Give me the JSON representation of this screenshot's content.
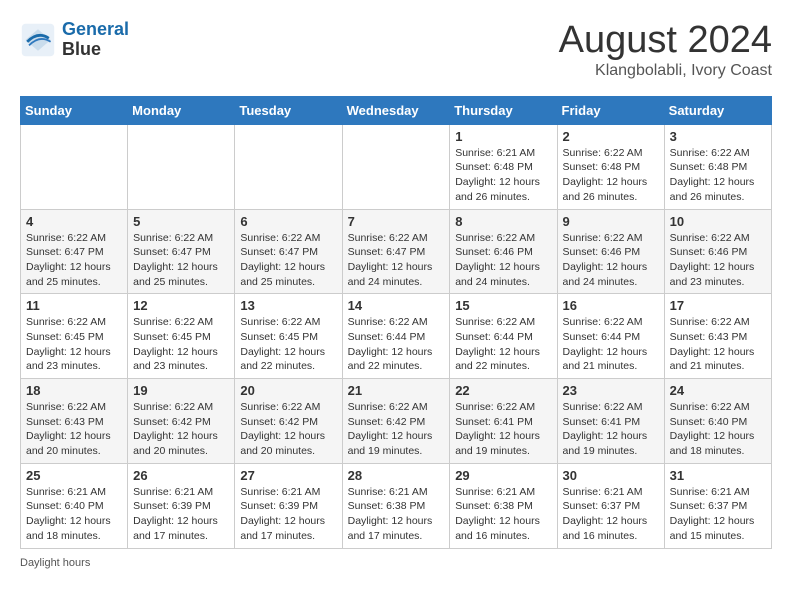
{
  "header": {
    "logo_line1": "General",
    "logo_line2": "Blue",
    "main_title": "August 2024",
    "subtitle": "Klangbolabli, Ivory Coast"
  },
  "footer": {
    "daylight_label": "Daylight hours"
  },
  "days_of_week": [
    "Sunday",
    "Monday",
    "Tuesday",
    "Wednesday",
    "Thursday",
    "Friday",
    "Saturday"
  ],
  "weeks": [
    {
      "days": [
        {
          "num": "",
          "info": ""
        },
        {
          "num": "",
          "info": ""
        },
        {
          "num": "",
          "info": ""
        },
        {
          "num": "",
          "info": ""
        },
        {
          "num": "1",
          "info": "Sunrise: 6:21 AM\nSunset: 6:48 PM\nDaylight: 12 hours\nand 26 minutes."
        },
        {
          "num": "2",
          "info": "Sunrise: 6:22 AM\nSunset: 6:48 PM\nDaylight: 12 hours\nand 26 minutes."
        },
        {
          "num": "3",
          "info": "Sunrise: 6:22 AM\nSunset: 6:48 PM\nDaylight: 12 hours\nand 26 minutes."
        }
      ]
    },
    {
      "days": [
        {
          "num": "4",
          "info": "Sunrise: 6:22 AM\nSunset: 6:47 PM\nDaylight: 12 hours\nand 25 minutes."
        },
        {
          "num": "5",
          "info": "Sunrise: 6:22 AM\nSunset: 6:47 PM\nDaylight: 12 hours\nand 25 minutes."
        },
        {
          "num": "6",
          "info": "Sunrise: 6:22 AM\nSunset: 6:47 PM\nDaylight: 12 hours\nand 25 minutes."
        },
        {
          "num": "7",
          "info": "Sunrise: 6:22 AM\nSunset: 6:47 PM\nDaylight: 12 hours\nand 24 minutes."
        },
        {
          "num": "8",
          "info": "Sunrise: 6:22 AM\nSunset: 6:46 PM\nDaylight: 12 hours\nand 24 minutes."
        },
        {
          "num": "9",
          "info": "Sunrise: 6:22 AM\nSunset: 6:46 PM\nDaylight: 12 hours\nand 24 minutes."
        },
        {
          "num": "10",
          "info": "Sunrise: 6:22 AM\nSunset: 6:46 PM\nDaylight: 12 hours\nand 23 minutes."
        }
      ]
    },
    {
      "days": [
        {
          "num": "11",
          "info": "Sunrise: 6:22 AM\nSunset: 6:45 PM\nDaylight: 12 hours\nand 23 minutes."
        },
        {
          "num": "12",
          "info": "Sunrise: 6:22 AM\nSunset: 6:45 PM\nDaylight: 12 hours\nand 23 minutes."
        },
        {
          "num": "13",
          "info": "Sunrise: 6:22 AM\nSunset: 6:45 PM\nDaylight: 12 hours\nand 22 minutes."
        },
        {
          "num": "14",
          "info": "Sunrise: 6:22 AM\nSunset: 6:44 PM\nDaylight: 12 hours\nand 22 minutes."
        },
        {
          "num": "15",
          "info": "Sunrise: 6:22 AM\nSunset: 6:44 PM\nDaylight: 12 hours\nand 22 minutes."
        },
        {
          "num": "16",
          "info": "Sunrise: 6:22 AM\nSunset: 6:44 PM\nDaylight: 12 hours\nand 21 minutes."
        },
        {
          "num": "17",
          "info": "Sunrise: 6:22 AM\nSunset: 6:43 PM\nDaylight: 12 hours\nand 21 minutes."
        }
      ]
    },
    {
      "days": [
        {
          "num": "18",
          "info": "Sunrise: 6:22 AM\nSunset: 6:43 PM\nDaylight: 12 hours\nand 20 minutes."
        },
        {
          "num": "19",
          "info": "Sunrise: 6:22 AM\nSunset: 6:42 PM\nDaylight: 12 hours\nand 20 minutes."
        },
        {
          "num": "20",
          "info": "Sunrise: 6:22 AM\nSunset: 6:42 PM\nDaylight: 12 hours\nand 20 minutes."
        },
        {
          "num": "21",
          "info": "Sunrise: 6:22 AM\nSunset: 6:42 PM\nDaylight: 12 hours\nand 19 minutes."
        },
        {
          "num": "22",
          "info": "Sunrise: 6:22 AM\nSunset: 6:41 PM\nDaylight: 12 hours\nand 19 minutes."
        },
        {
          "num": "23",
          "info": "Sunrise: 6:22 AM\nSunset: 6:41 PM\nDaylight: 12 hours\nand 19 minutes."
        },
        {
          "num": "24",
          "info": "Sunrise: 6:22 AM\nSunset: 6:40 PM\nDaylight: 12 hours\nand 18 minutes."
        }
      ]
    },
    {
      "days": [
        {
          "num": "25",
          "info": "Sunrise: 6:21 AM\nSunset: 6:40 PM\nDaylight: 12 hours\nand 18 minutes."
        },
        {
          "num": "26",
          "info": "Sunrise: 6:21 AM\nSunset: 6:39 PM\nDaylight: 12 hours\nand 17 minutes."
        },
        {
          "num": "27",
          "info": "Sunrise: 6:21 AM\nSunset: 6:39 PM\nDaylight: 12 hours\nand 17 minutes."
        },
        {
          "num": "28",
          "info": "Sunrise: 6:21 AM\nSunset: 6:38 PM\nDaylight: 12 hours\nand 17 minutes."
        },
        {
          "num": "29",
          "info": "Sunrise: 6:21 AM\nSunset: 6:38 PM\nDaylight: 12 hours\nand 16 minutes."
        },
        {
          "num": "30",
          "info": "Sunrise: 6:21 AM\nSunset: 6:37 PM\nDaylight: 12 hours\nand 16 minutes."
        },
        {
          "num": "31",
          "info": "Sunrise: 6:21 AM\nSunset: 6:37 PM\nDaylight: 12 hours\nand 15 minutes."
        }
      ]
    }
  ]
}
